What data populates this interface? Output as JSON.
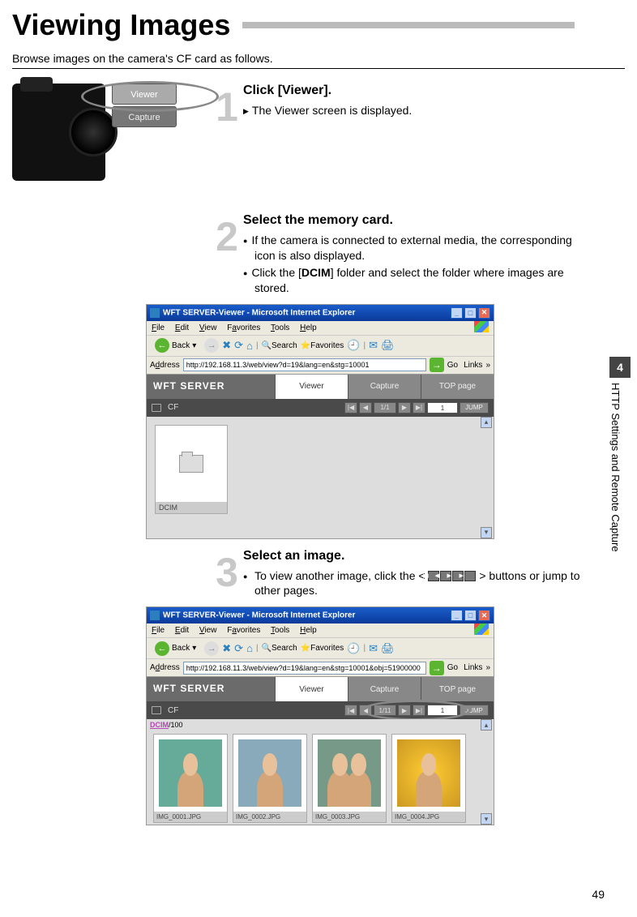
{
  "page": {
    "title": "Viewing Images",
    "intro": "Browse images on the camera's CF card as follows.",
    "page_number": "49"
  },
  "sidebar": {
    "chapter_num": "4",
    "chapter_title": "HTTP Settings and Remote Capture"
  },
  "steps": {
    "s1": {
      "num": "1",
      "title": "Click [Viewer].",
      "line1": "The Viewer screen is displayed."
    },
    "s2": {
      "num": "2",
      "title": "Select the memory card.",
      "line1": "If the camera is connected to external media, the corresponding icon is also displayed.",
      "line2_a": "Click the [",
      "line2_b": "DCIM",
      "line2_c": "] folder and select the folder where images are stored."
    },
    "s3": {
      "num": "3",
      "title": "Select an image.",
      "line1_a": "To view another image, click the <",
      "line1_b": "> buttons or jump to other pages."
    }
  },
  "tabs": {
    "viewer": "Viewer",
    "capture": "Capture"
  },
  "browser": {
    "window_title": "WFT SERVER-Viewer - Microsoft Internet Explorer",
    "menu": {
      "file": "File",
      "edit": "Edit",
      "view": "View",
      "fav": "Favorites",
      "tools": "Tools",
      "help": "Help"
    },
    "back": "Back",
    "search": "Search",
    "favorites": "Favorites",
    "address_label": "Address",
    "url1": "http://192.168.11.3/web/view?d=19&lang=en&stg=10001",
    "url2": "http://192.168.11.3/web/view?d=19&lang=en&stg=10001&obj=51900000",
    "go": "Go",
    "links": "Links",
    "wft": "WFT SERVER",
    "tab_viewer": "Viewer",
    "tab_capture": "Capture",
    "tab_top": "TOP page",
    "cf": "CF",
    "page1": "1/1",
    "page2": "1/11",
    "jump": "JUMP",
    "jump_input1": "1",
    "jump_input2": "1",
    "dcim": "DCIM",
    "dcim_sub": "100",
    "thumbs": [
      "IMG_0001.JPG",
      "IMG_0002.JPG",
      "IMG_0003.JPG",
      "IMG_0004.JPG"
    ]
  }
}
